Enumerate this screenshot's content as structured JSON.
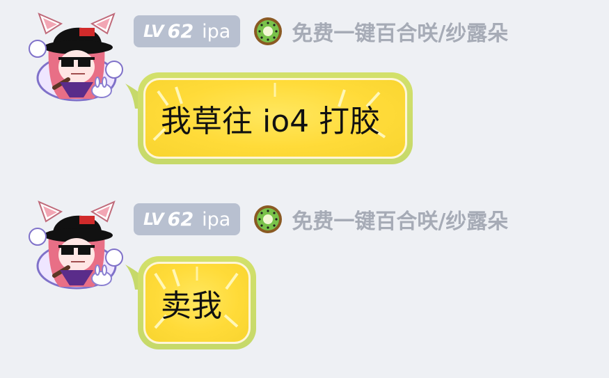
{
  "messages": [
    {
      "level_prefix": "LV",
      "level_number": "62",
      "level_tag": "ipa",
      "username": "免费一键百合咲/纱露朵",
      "badge_icon": "kiwi-icon",
      "text": "我草往 io4 打胶"
    },
    {
      "level_prefix": "LV",
      "level_number": "62",
      "level_tag": "ipa",
      "username": "免费一键百合咲/纱露朵",
      "badge_icon": "kiwi-icon",
      "text": "卖我"
    }
  ],
  "colors": {
    "background": "#eef0f4",
    "level_badge": "#b8c0d0",
    "username": "#a6abb6",
    "bubble_border": "#c6d96a",
    "bubble_fill": "#ffdb39"
  }
}
